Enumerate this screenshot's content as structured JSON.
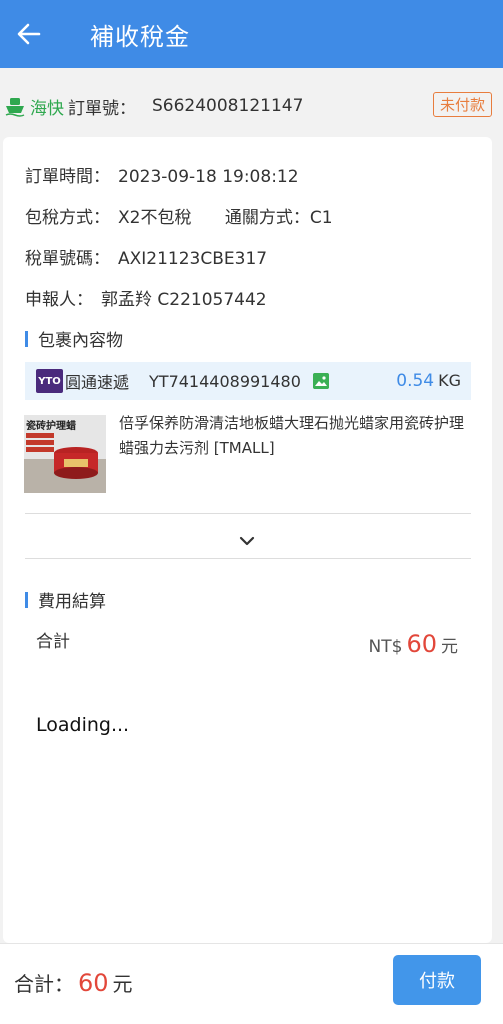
{
  "header": {
    "title": "補收稅金"
  },
  "order": {
    "ship_type": "海快",
    "order_label": "訂單號：",
    "order_no": "S6624008121147",
    "status_badge": "未付款"
  },
  "info": {
    "order_time_label": "訂單時間：",
    "order_time": "2023-09-18 19:08:12",
    "tax_method_label": "包稅方式：",
    "tax_method": "X2不包稅",
    "clearance_label": "通關方式：",
    "clearance": "C1",
    "tax_no_label": "稅單號碼：",
    "tax_no": "AXI21123CBE317",
    "declarant_label": "申報人：",
    "declarant": "郭孟羚 C221057442"
  },
  "package": {
    "section_title": "包裹內容物",
    "courier_logo_text": "YTO",
    "courier_name": "圓通速遞",
    "tracking_no": "YT7414408991480",
    "weight_value": "0.54",
    "weight_unit": "KG",
    "product_thumb_caption": "瓷砖护理蜡",
    "product_desc": "倍孚保养防滑清洁地板蜡大理石抛光蜡家用瓷砖护理蜡强力去污剂 [TMALL]"
  },
  "fees": {
    "section_title": "費用結算",
    "total_label": "合計",
    "currency": "NT$",
    "total_amount": "60",
    "unit": "元",
    "loading_text": "Loading..."
  },
  "footer": {
    "total_label": "合計：",
    "total_amount": "60",
    "unit": "元",
    "pay_label": "付款"
  },
  "colors": {
    "primary": "#3f8be6",
    "accent_red": "#e2473a",
    "ship_green": "#2fa84f",
    "badge_orange": "#e87d3e"
  }
}
